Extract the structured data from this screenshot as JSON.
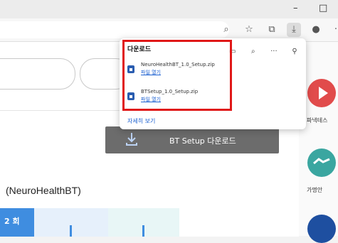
{
  "window": {
    "minimize_glyph": "–",
    "maximize_glyph": "□"
  },
  "downloads_popup": {
    "title": "다운로드",
    "items": [
      {
        "filename": "NeuroHealthBT_1.0_Setup.zip",
        "action": "파일 열기"
      },
      {
        "filename": "BTSetup_1.0_Setup.zip",
        "action": "파일 열기"
      }
    ],
    "more_link": "자세히 보기"
  },
  "page": {
    "download_button_label": "BT Setup 다운로드",
    "section_title": "(NeuroHealthBT)",
    "table_first_cell": "2 회"
  },
  "sidebar": {
    "items": [
      {
        "label": "파낵테스",
        "color": "#e14b4b"
      },
      {
        "label": "가명안",
        "color": "#3aa6a0"
      },
      {
        "label": "",
        "color": "#1e4fa0"
      }
    ]
  },
  "colors": {
    "highlight": "#e01818",
    "link": "#1a5fd0",
    "banner": "#6c6c6c"
  }
}
